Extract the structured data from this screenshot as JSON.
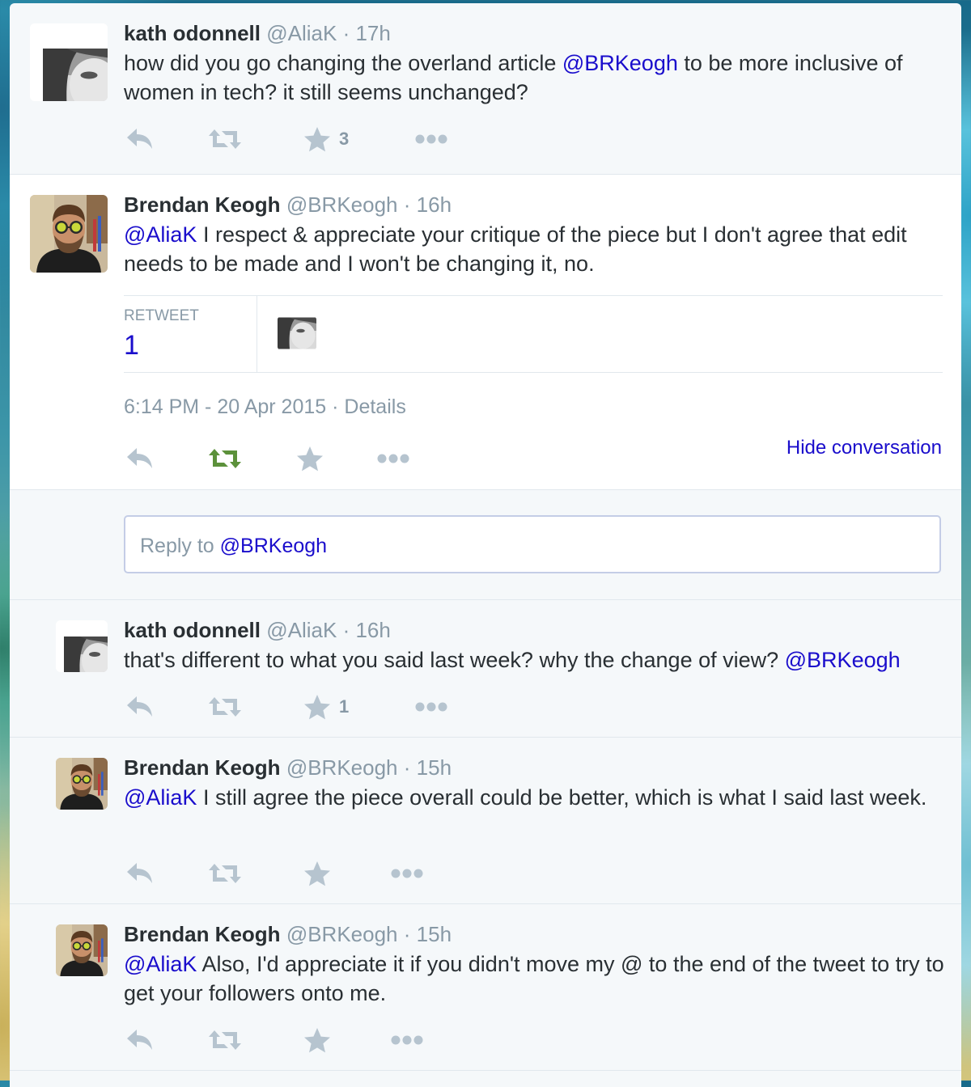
{
  "tweets": [
    {
      "name": "kath odonnell",
      "handle": "@AliaK",
      "sep": "·",
      "time": "17h",
      "text_before": "how did you go changing the overland article ",
      "mention": "@BRKeogh",
      "text_after": " to be more inclusive of women in tech? it still seems unchanged?",
      "favorite_count": "3"
    },
    {
      "name": "Brendan Keogh",
      "handle": "@BRKeogh",
      "sep": "·",
      "time": "16h",
      "mention": "@AliaK",
      "text_after": " I respect & appreciate your critique of the piece but I don't agree that edit needs to be made and I won't be changing it, no.",
      "retweet_label": "RETWEET",
      "retweet_count": "1",
      "timestamp": "6:14 PM - 20 Apr 2015",
      "meta_sep": "·",
      "details_label": "Details",
      "hide_conversation": "Hide conversation",
      "reply_placeholder": "Reply to ",
      "reply_mention": "@BRKeogh"
    },
    {
      "name": "kath odonnell",
      "handle": "@AliaK",
      "sep": "·",
      "time": "16h",
      "text_before": "that's different to what you said last week? why the change of view? ",
      "mention": "@BRKeogh",
      "favorite_count": "1"
    },
    {
      "name": "Brendan Keogh",
      "handle": "@BRKeogh",
      "sep": "·",
      "time": "15h",
      "mention": "@AliaK",
      "text_after": " I still agree the piece overall could be better, which is what I said last week."
    },
    {
      "name": "Brendan Keogh",
      "handle": "@BRKeogh",
      "sep": "·",
      "time": "15h",
      "mention": "@AliaK",
      "text_after": " Also, I'd appreciate it if you didn't move my @ to the end of the tweet to try to get your followers onto me."
    }
  ],
  "icons": {
    "reply": "reply-icon",
    "retweet": "retweet-icon",
    "favorite": "star-icon",
    "more": "more-icon"
  },
  "colors": {
    "link": "#1a0dcc",
    "retweeted": "#5c913b",
    "icon": "#b6c4cf",
    "muted": "#8899a6",
    "text": "#292f33"
  }
}
